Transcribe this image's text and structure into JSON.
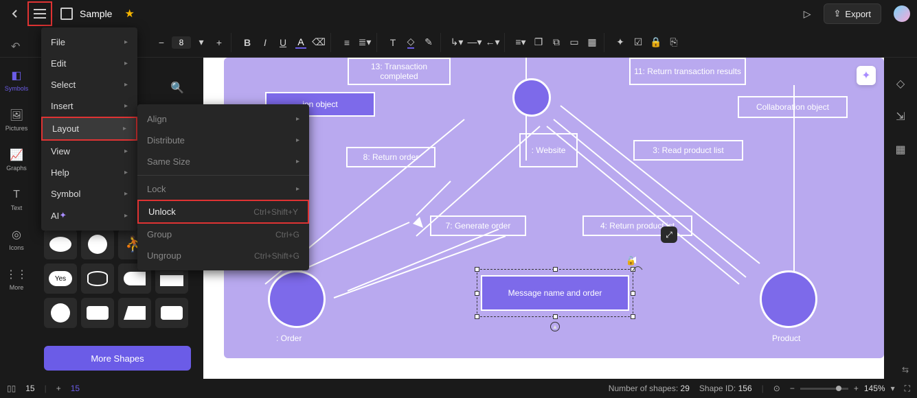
{
  "header": {
    "title": "Sample",
    "export_label": "Export"
  },
  "toolbar": {
    "font_size": "8"
  },
  "left_rail": [
    {
      "label": "Symbols"
    },
    {
      "label": "Pictures"
    },
    {
      "label": "Graphs"
    },
    {
      "label": "Text"
    },
    {
      "label": "Icons"
    },
    {
      "label": "More"
    }
  ],
  "shapes_panel": {
    "yes_label": "Yes",
    "more_shapes_label": "More Shapes"
  },
  "menu": {
    "items": [
      {
        "label": "File"
      },
      {
        "label": "Edit"
      },
      {
        "label": "Select"
      },
      {
        "label": "Insert"
      },
      {
        "label": "Layout"
      },
      {
        "label": "View"
      },
      {
        "label": "Help"
      },
      {
        "label": "Symbol"
      },
      {
        "label": "AI"
      }
    ]
  },
  "submenu": {
    "items": [
      {
        "label": "Align"
      },
      {
        "label": "Distribute"
      },
      {
        "label": "Same Size"
      },
      {
        "label": "Lock"
      },
      {
        "label": "Unlock",
        "shortcut": "Ctrl+Shift+Y"
      },
      {
        "label": "Group",
        "shortcut": "Ctrl+G"
      },
      {
        "label": "Ungroup",
        "shortcut": "Ctrl+Shift+G"
      }
    ]
  },
  "canvas": {
    "nodes": {
      "n13": "13: Transaction completed",
      "n11": "11: Return transaction results",
      "nact": "ion object",
      "ncollab": "Collaboration object",
      "n8": "8: Return order",
      "nweb": ": Website",
      "n3": "3: Read product list",
      "n7": "7: Generate order",
      "n4": "4: Return product ist",
      "nmsg": "Message name and order",
      "lorder": ": Order",
      "lproduct": "Product"
    }
  },
  "status": {
    "page_count": "15",
    "page_current": "15",
    "shapes_label": "Number of shapes:",
    "shapes_count": "29",
    "shapeid_label": "Shape ID:",
    "shapeid": "156",
    "zoom": "145%"
  }
}
